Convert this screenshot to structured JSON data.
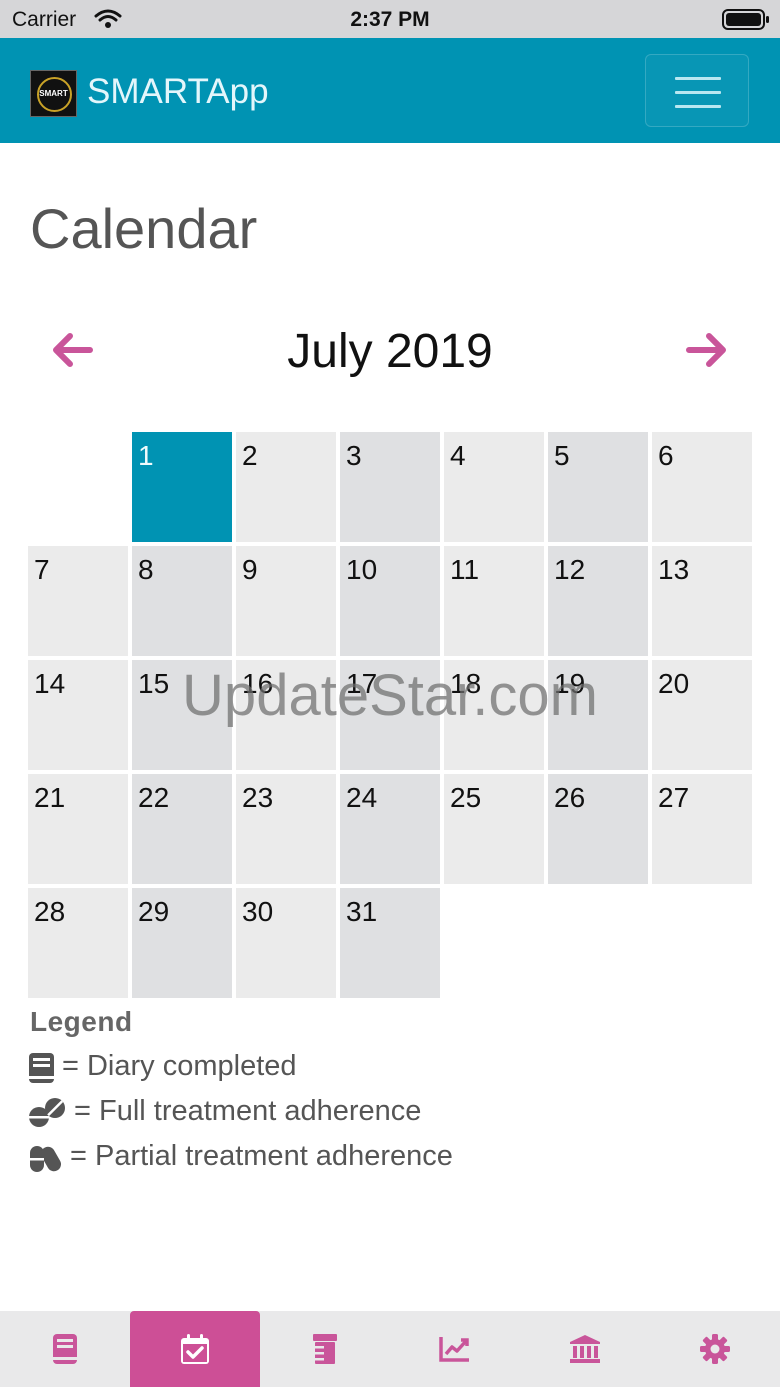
{
  "status_bar": {
    "carrier": "Carrier",
    "time": "2:37 PM"
  },
  "header": {
    "app_name": "SMARTApp",
    "logo_text": "SMART"
  },
  "page": {
    "title": "Calendar"
  },
  "calendar": {
    "month_label": "July 2019",
    "leading_blank_days": 1,
    "days": [
      "1",
      "2",
      "3",
      "4",
      "5",
      "6",
      "7",
      "8",
      "9",
      "10",
      "11",
      "12",
      "13",
      "14",
      "15",
      "16",
      "17",
      "18",
      "19",
      "20",
      "21",
      "22",
      "23",
      "24",
      "25",
      "26",
      "27",
      "28",
      "29",
      "30",
      "31"
    ],
    "selected_day": "1"
  },
  "watermark": "UpdateStar.com",
  "legend": {
    "title": "Legend",
    "items": [
      {
        "icon": "book-icon",
        "label": "= Diary completed"
      },
      {
        "icon": "pills-icon",
        "label": "= Full treatment adherence"
      },
      {
        "icon": "capsules-icon",
        "label": "= Partial treatment adherence"
      }
    ]
  },
  "bottom_nav": {
    "tabs": [
      {
        "icon": "book-icon",
        "active": false
      },
      {
        "icon": "calendar-check-icon",
        "active": true
      },
      {
        "icon": "prescription-bottle-icon",
        "active": false
      },
      {
        "icon": "chart-line-icon",
        "active": false
      },
      {
        "icon": "university-icon",
        "active": false
      },
      {
        "icon": "gear-icon",
        "active": false
      }
    ]
  },
  "colors": {
    "header_bg": "#0093b3",
    "accent_pink": "#cd4f96",
    "cell_light": "#ebebeb",
    "cell_dark": "#dfe0e2"
  }
}
